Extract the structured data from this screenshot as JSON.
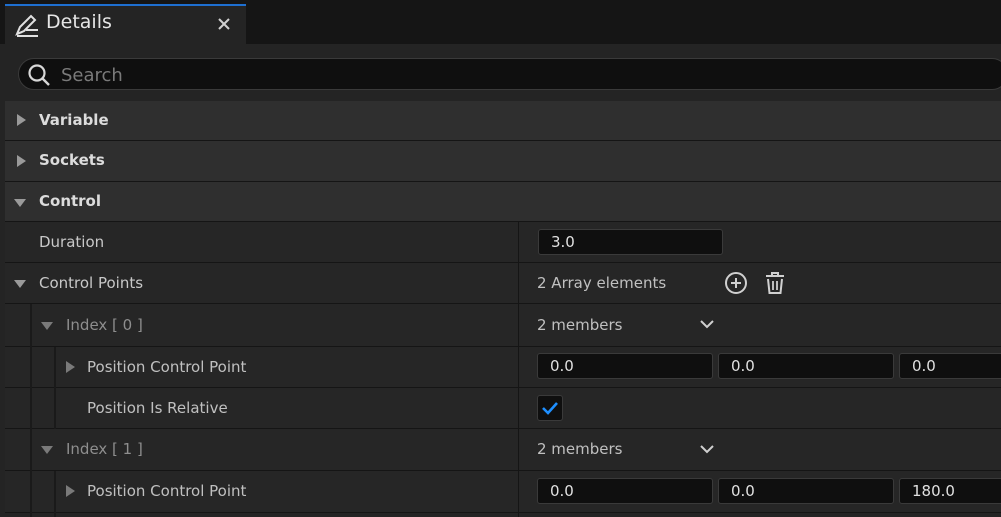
{
  "tab": {
    "title": "Details",
    "icon": "details-pencil-icon",
    "accent": "#1e6fd0"
  },
  "search": {
    "placeholder": "Search",
    "value": ""
  },
  "categories": {
    "variable": "Variable",
    "sockets": "Sockets",
    "control": "Control"
  },
  "duration": {
    "label": "Duration",
    "value": "3.0"
  },
  "control_points": {
    "label": "Control Points",
    "summary": "2 Array elements"
  },
  "index0": {
    "label": "Index [ 0 ]",
    "summary": "2 members",
    "position_label": "Position Control Point",
    "position": [
      "0.0",
      "0.0",
      "0.0"
    ],
    "relative_label": "Position Is Relative",
    "relative_checked": true
  },
  "index1": {
    "label": "Index [ 1 ]",
    "summary": "2 members",
    "position_label": "Position Control Point",
    "position": [
      "0.0",
      "0.0",
      "180.0"
    ]
  },
  "colors": {
    "checkmark": "#1e8fff",
    "panel_bg": "#242424",
    "field_bg": "#0f0f0f"
  }
}
